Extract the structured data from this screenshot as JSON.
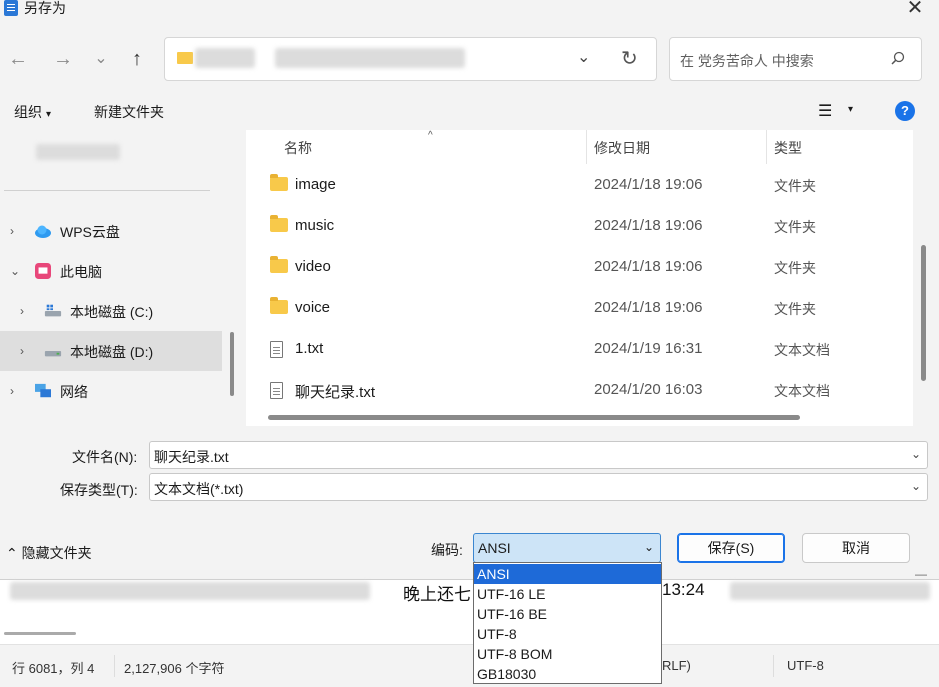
{
  "window": {
    "title": "另存为",
    "close_glyph": "✕"
  },
  "nav": {
    "back": "←",
    "forward": "→",
    "recent": "⌄",
    "up": "↑"
  },
  "addressbar": {
    "chevron": "⌄",
    "refresh": "↻"
  },
  "search": {
    "placeholder": "在 党务苦命人 中搜索"
  },
  "toolbar": {
    "organize": "组织",
    "organize_caret": "▾",
    "new_folder": "新建文件夹",
    "view_glyph": "☰",
    "view_caret": "▾",
    "help": "?"
  },
  "sidebar": {
    "items": [
      {
        "label": "WPS云盘",
        "chevron": "›"
      },
      {
        "label": "此电脑",
        "chevron": "⌄"
      },
      {
        "label": "本地磁盘 (C:)",
        "chevron": "›"
      },
      {
        "label": "本地磁盘 (D:)",
        "chevron": "›"
      },
      {
        "label": "网络",
        "chevron": "›"
      }
    ]
  },
  "filelist": {
    "sort_caret": "^",
    "columns": {
      "name": "名称",
      "date": "修改日期",
      "type": "类型"
    },
    "rows": [
      {
        "name": "image",
        "date": "2024/1/18 19:06",
        "type": "文件夹",
        "kind": "folder"
      },
      {
        "name": "music",
        "date": "2024/1/18 19:06",
        "type": "文件夹",
        "kind": "folder"
      },
      {
        "name": "video",
        "date": "2024/1/18 19:06",
        "type": "文件夹",
        "kind": "folder"
      },
      {
        "name": "voice",
        "date": "2024/1/18 19:06",
        "type": "文件夹",
        "kind": "folder"
      },
      {
        "name": "1.txt",
        "date": "2024/1/19 16:31",
        "type": "文本文档",
        "kind": "txt"
      },
      {
        "name": "聊天纪录.txt",
        "date": "2024/1/20 16:03",
        "type": "文本文档",
        "kind": "txt"
      }
    ]
  },
  "form": {
    "filename_label": "文件名(N):",
    "filename_value": "聊天纪录.txt",
    "filetype_label": "保存类型(T):",
    "filetype_value": "文本文档(*.txt)",
    "chevron": "⌄"
  },
  "footer": {
    "hide_folders": "⌃ 隐藏文件夹",
    "encoding_label": "编码:",
    "encoding_value": "ANSI",
    "encoding_chevron": "⌄",
    "save": "保存(S)",
    "cancel": "取消"
  },
  "encoding_options": [
    "ANSI",
    "UTF-16 LE",
    "UTF-16 BE",
    "UTF-8",
    "UTF-8 BOM",
    "GB18030"
  ],
  "background_editor": {
    "line_text_1": "晚上还七",
    "line_text_2": "13:24",
    "minimize": "—",
    "status": {
      "position": "行 6081，列 4",
      "chars": "2,127,906 个字符",
      "eol": "RLF)",
      "encoding": "UTF-8"
    }
  }
}
